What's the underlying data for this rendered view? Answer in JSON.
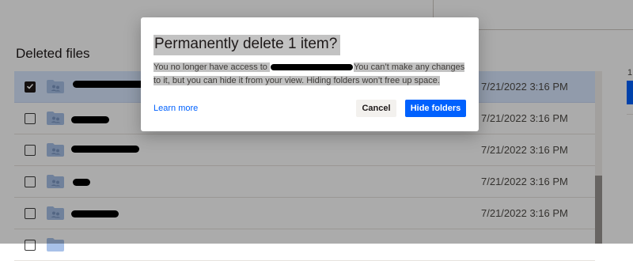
{
  "page": {
    "section_title": "Deleted files",
    "right_panel_page": "1"
  },
  "files": [
    {
      "date": "7/21/2022 3:16 PM",
      "selected": true
    },
    {
      "date": "7/21/2022 3:16 PM",
      "selected": false
    },
    {
      "date": "7/21/2022 3:16 PM",
      "selected": false
    },
    {
      "date": "7/21/2022 3:16 PM",
      "selected": false
    },
    {
      "date": "7/21/2022 3:16 PM",
      "selected": false
    },
    {
      "date": "",
      "selected": false
    }
  ],
  "dialog": {
    "title": "Permanently delete 1 item?",
    "body_before": "You no longer have access to ",
    "body_after": "You can’t make any changes to it, but you can hide it from your view. Hiding folders won’t free up space.",
    "learn_more_label": "Learn more",
    "cancel_label": "Cancel",
    "confirm_label": "Hide folders"
  },
  "colors": {
    "accent": "#0061fe",
    "selected_row": "#d9e7ff",
    "folder": "#a8c1e8"
  },
  "icons": {
    "checkbox_checked": "check-icon",
    "file_type": "shared-folder-icon"
  }
}
